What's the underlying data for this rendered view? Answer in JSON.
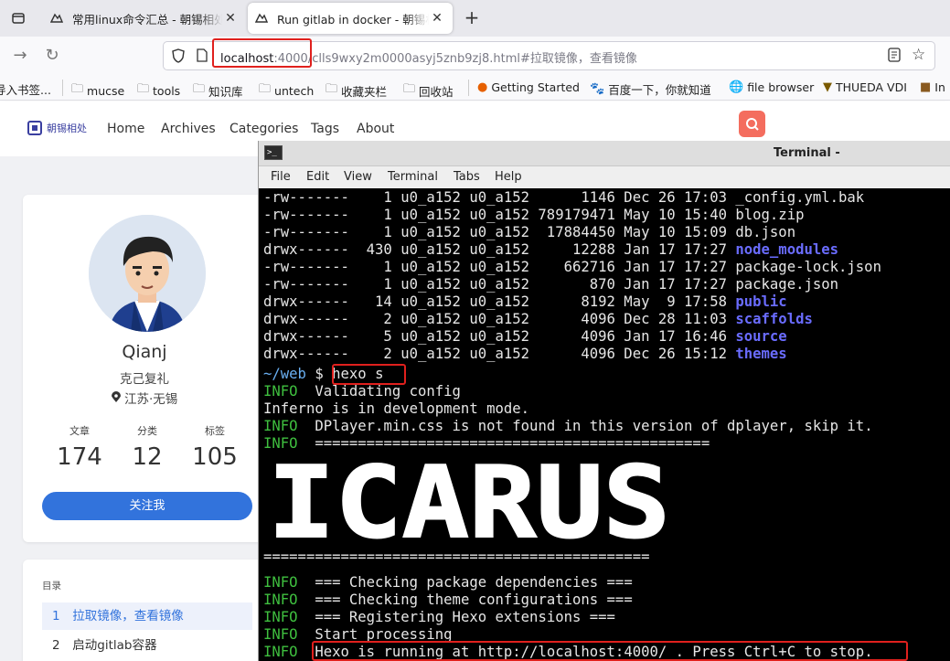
{
  "browser": {
    "tabs": [
      {
        "title": "常用linux命令汇总 - 朝锡相处",
        "icon": "github-icon"
      },
      {
        "title": "Run gitlab in docker - 朝锡相处",
        "icon": "github-icon"
      }
    ],
    "url": {
      "host": "localhost",
      "rest": ":4000/clls9wxy2m0000asyj5znb9zj8.html#拉取镜像，查看镜像"
    },
    "bookmarks": [
      {
        "label": "导入书签...",
        "icon": "import-icon"
      },
      {
        "label": "mucse",
        "icon": "folder-icon"
      },
      {
        "label": "tools",
        "icon": "folder-icon"
      },
      {
        "label": "知识库",
        "icon": "folder-icon"
      },
      {
        "label": "untech",
        "icon": "folder-icon"
      },
      {
        "label": "收藏夹栏",
        "icon": "folder-icon"
      },
      {
        "label": "回收站",
        "icon": "folder-icon"
      },
      {
        "label": "Getting Started",
        "icon": "firefox-icon"
      },
      {
        "label": "百度一下，你就知道",
        "icon": "baidu-icon"
      },
      {
        "label": "file browser",
        "icon": "globe-icon"
      },
      {
        "label": "THUEDA VDI",
        "icon": "shield-icon"
      },
      {
        "label": "In",
        "icon": "image-icon"
      }
    ]
  },
  "site": {
    "logo": "朝锡相处",
    "menu": [
      "Home",
      "Archives",
      "Categories",
      "Tags",
      "About"
    ],
    "profile": {
      "name": "Qianj",
      "bio": "克己复礼",
      "location": "江苏·无锡",
      "stats": [
        {
          "label": "文章",
          "value": "174"
        },
        {
          "label": "分类",
          "value": "12"
        },
        {
          "label": "标签",
          "value": "105"
        }
      ],
      "follow": "关注我"
    },
    "toc": {
      "title": "目录",
      "items": [
        {
          "num": "1",
          "label": "拉取镜像，查看镜像",
          "active": true
        },
        {
          "num": "2",
          "label": "启动gitlab容器",
          "active": false
        }
      ]
    }
  },
  "terminal": {
    "title": "Terminal -",
    "menu": [
      "File",
      "Edit",
      "View",
      "Terminal",
      "Tabs",
      "Help"
    ],
    "listing": [
      {
        "perm": "-rw-------",
        "links": "1",
        "owner": "u0_a152",
        "group": "u0_a152",
        "size": "1146",
        "date": "Dec 26 17:03",
        "name": "_config.yml.bak",
        "dir": false
      },
      {
        "perm": "-rw-------",
        "links": "1",
        "owner": "u0_a152",
        "group": "u0_a152",
        "size": "789179471",
        "date": "May 10 15:40",
        "name": "blog.zip",
        "dir": false
      },
      {
        "perm": "-rw-------",
        "links": "1",
        "owner": "u0_a152",
        "group": "u0_a152",
        "size": "17884450",
        "date": "May 10 15:09",
        "name": "db.json",
        "dir": false
      },
      {
        "perm": "drwx------",
        "links": "430",
        "owner": "u0_a152",
        "group": "u0_a152",
        "size": "12288",
        "date": "Jan 17 17:27",
        "name": "node_modules",
        "dir": true
      },
      {
        "perm": "-rw-------",
        "links": "1",
        "owner": "u0_a152",
        "group": "u0_a152",
        "size": "662716",
        "date": "Jan 17 17:27",
        "name": "package-lock.json",
        "dir": false
      },
      {
        "perm": "-rw-------",
        "links": "1",
        "owner": "u0_a152",
        "group": "u0_a152",
        "size": "870",
        "date": "Jan 17 17:27",
        "name": "package.json",
        "dir": false
      },
      {
        "perm": "drwx------",
        "links": "14",
        "owner": "u0_a152",
        "group": "u0_a152",
        "size": "8192",
        "date": "May  9 17:58",
        "name": "public",
        "dir": true
      },
      {
        "perm": "drwx------",
        "links": "2",
        "owner": "u0_a152",
        "group": "u0_a152",
        "size": "4096",
        "date": "Dec 28 11:03",
        "name": "scaffolds",
        "dir": true
      },
      {
        "perm": "drwx------",
        "links": "5",
        "owner": "u0_a152",
        "group": "u0_a152",
        "size": "4096",
        "date": "Jan 17 16:46",
        "name": "source",
        "dir": true
      },
      {
        "perm": "drwx------",
        "links": "2",
        "owner": "u0_a152",
        "group": "u0_a152",
        "size": "4096",
        "date": "Dec 26 15:12",
        "name": "themes",
        "dir": true
      }
    ],
    "prompt_path": "~/web",
    "prompt_symbol": "$",
    "command": "hexo s",
    "output": [
      {
        "tag": "INFO",
        "text": "Validating config"
      },
      {
        "tag": "",
        "text": "Inferno is in development mode."
      },
      {
        "tag": "INFO",
        "text": "DPlayer.min.css is not found in this version of dplayer, skip it."
      },
      {
        "tag": "INFO",
        "text": "=============================================="
      }
    ],
    "banner_text": "ICARUS",
    "banner_rule": "=============================================",
    "output_after": [
      {
        "tag": "INFO",
        "text": "=== Checking package dependencies ==="
      },
      {
        "tag": "INFO",
        "text": "=== Checking theme configurations ==="
      },
      {
        "tag": "INFO",
        "text": "=== Registering Hexo extensions ==="
      },
      {
        "tag": "INFO",
        "text": "Start processing"
      },
      {
        "tag": "INFO",
        "text": "Hexo is running at http://localhost:4000/ . Press Ctrl+C to stop."
      }
    ]
  }
}
